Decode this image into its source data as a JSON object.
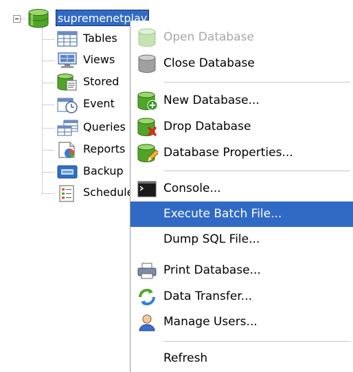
{
  "tree": {
    "root_label": "supremenetplay",
    "children": [
      {
        "label": "Tables",
        "icon": "table-icon"
      },
      {
        "label": "Views",
        "icon": "view-icon"
      },
      {
        "label": "Stored",
        "icon": "stored-procedure-icon"
      },
      {
        "label": "Event",
        "icon": "event-icon"
      },
      {
        "label": "Queries",
        "icon": "query-icon"
      },
      {
        "label": "Reports",
        "icon": "report-icon"
      },
      {
        "label": "Backup",
        "icon": "backup-icon"
      },
      {
        "label": "Schedule",
        "icon": "schedule-icon"
      }
    ]
  },
  "context_menu": {
    "items": [
      {
        "label": "Open Database",
        "icon": "open-database-icon",
        "state": "disabled"
      },
      {
        "label": "Close Database",
        "icon": "close-database-icon",
        "state": "normal"
      },
      {
        "label": "New Database...",
        "icon": "new-database-icon",
        "state": "normal"
      },
      {
        "label": "Drop Database",
        "icon": "drop-database-icon",
        "state": "normal"
      },
      {
        "label": "Database Properties...",
        "icon": "database-properties-icon",
        "state": "normal"
      },
      {
        "label": "Console...",
        "icon": "console-icon",
        "state": "normal"
      },
      {
        "label": "Execute Batch File...",
        "icon": "",
        "state": "selected"
      },
      {
        "label": "Dump SQL File...",
        "icon": "",
        "state": "normal"
      },
      {
        "label": "Print Database...",
        "icon": "printer-icon",
        "state": "normal"
      },
      {
        "label": "Data Transfer...",
        "icon": "data-transfer-icon",
        "state": "normal"
      },
      {
        "label": "Manage Users...",
        "icon": "users-icon",
        "state": "normal"
      },
      {
        "label": "Refresh",
        "icon": "",
        "state": "normal"
      }
    ]
  },
  "colors": {
    "selection": "#316ac5",
    "disabled_text": "#a7a7a7",
    "database_green": "#4fa528"
  }
}
